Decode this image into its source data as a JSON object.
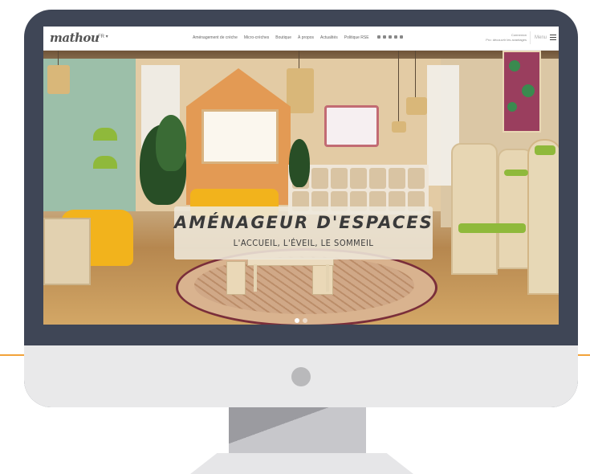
{
  "site": {
    "logo": "mathou",
    "language": "FR ▾",
    "nav": [
      "Aménagement de crèche",
      "Micro-crèches",
      "Boutique",
      "À propos",
      "Actualités",
      "Politique RSE"
    ],
    "connect_label": "Connexion",
    "connect_sub": "Pro: découvrir les avantages",
    "menu_label": "Menu"
  },
  "hero": {
    "title": "AMÉNAGEUR D'ESPACES",
    "subtitle": "L'ACCUEIL, L'ÉVEIL, LE SOMMEIL",
    "slide_count": 2,
    "active_slide": 1
  },
  "colors": {
    "monitor_bezel": "#3f4656",
    "monitor_chin": "#e9e9ea",
    "accent_line": "#f2a33a",
    "rug_border": "#7a2e3a"
  }
}
